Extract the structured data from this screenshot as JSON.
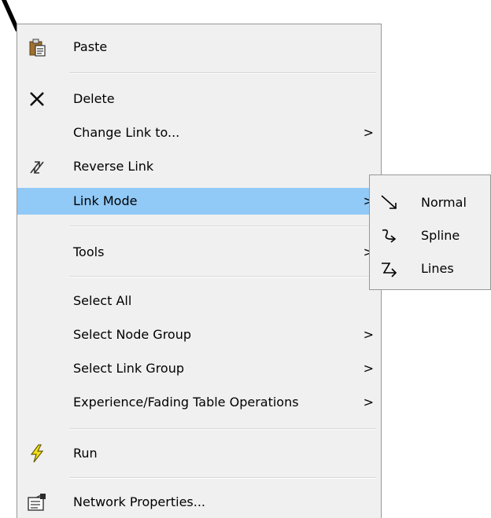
{
  "menu": {
    "items": {
      "paste": {
        "label": "Paste",
        "icon": "clipboard-paste-icon"
      },
      "delete": {
        "label": "Delete",
        "icon": "delete-x-icon"
      },
      "change_link": {
        "label": "Change Link to...",
        "submenu_arrow": ">"
      },
      "reverse_link": {
        "label": "Reverse Link",
        "icon": "reverse-arrows-icon"
      },
      "link_mode": {
        "label": "Link Mode",
        "submenu_arrow": ">",
        "highlighted": true
      },
      "tools": {
        "label": "Tools",
        "submenu_arrow": ">"
      },
      "select_all": {
        "label": "Select All"
      },
      "select_node_group": {
        "label": "Select Node Group",
        "submenu_arrow": ">"
      },
      "select_link_group": {
        "label": "Select Link Group",
        "submenu_arrow": ">"
      },
      "experience_fading": {
        "label": "Experience/Fading Table Operations",
        "submenu_arrow": ">"
      },
      "run": {
        "label": "Run",
        "icon": "lightning-icon"
      },
      "network_properties": {
        "label": "Network Properties...",
        "icon": "properties-icon"
      }
    }
  },
  "submenu": {
    "items": {
      "normal": {
        "label": "Normal",
        "icon": "straight-link-icon"
      },
      "spline": {
        "label": "Spline",
        "icon": "spline-link-icon"
      },
      "lines": {
        "label": "Lines",
        "icon": "lines-link-icon"
      }
    }
  },
  "colors": {
    "menu_background": "#f0f0f0",
    "highlight": "#91c9f7",
    "border": "#979797",
    "separator": "#d7d7d7",
    "run_icon": "#f2e01c"
  }
}
